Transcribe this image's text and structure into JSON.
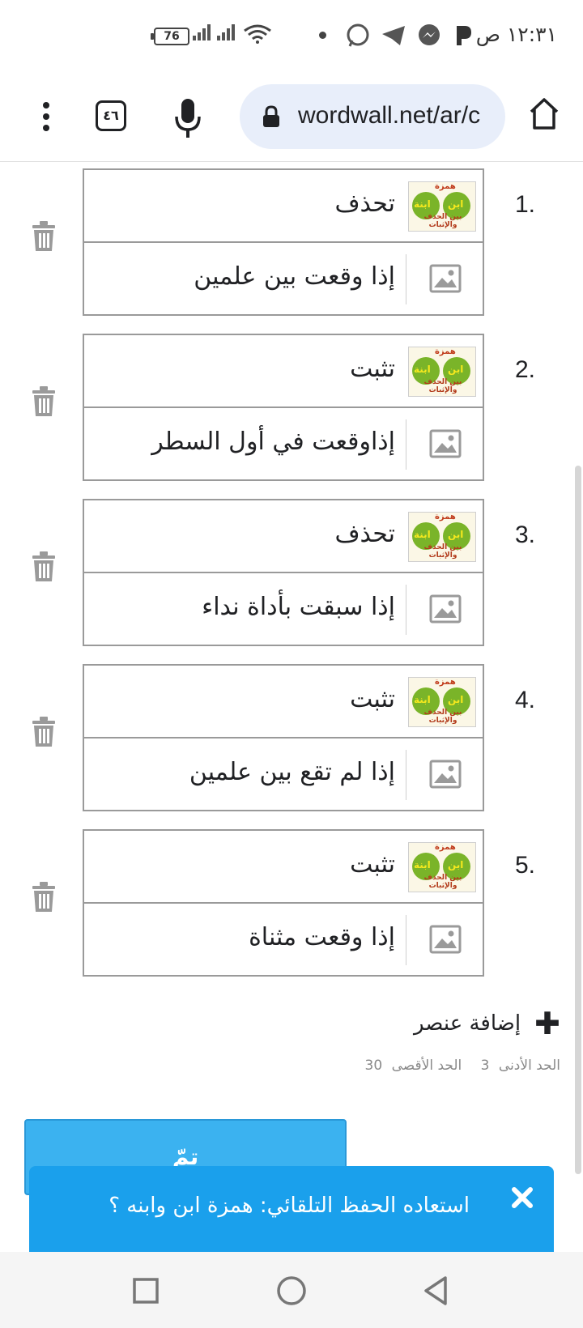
{
  "status_bar": {
    "time": "١٢:٣١ ص",
    "battery": "76",
    "notification_icons": [
      "p-app-icon",
      "messenger-icon",
      "telegram-icon",
      "whatsapp-icon"
    ]
  },
  "browser": {
    "url": "wordwall.net/ar/c",
    "tab_count": "٤٦"
  },
  "items": [
    {
      "number": "1.",
      "top_text": "تحذف",
      "bottom_text": "إذا وقعت بين علمين"
    },
    {
      "number": "2.",
      "top_text": "تثبت",
      "bottom_text": "إذاوقعت في أول السطر"
    },
    {
      "number": "3.",
      "top_text": "تحذف",
      "bottom_text": "إذا سبقت بأداة نداء"
    },
    {
      "number": "4.",
      "top_text": "تثبت",
      "bottom_text": "إذا لم تقع بين علمين"
    },
    {
      "number": "5.",
      "top_text": "تثبت",
      "bottom_text": "إذا وقعت مثناة"
    }
  ],
  "thumbnail": {
    "word_left": "ابنة",
    "word_right": "ابن",
    "top_word": "همزة",
    "footer": "بين الحذف والإثبات"
  },
  "add_item_label": "إضافة عنصر",
  "limits": {
    "min_label": "الحد الأدنى",
    "min_value": "3",
    "max_label": "الحد الأقصى",
    "max_value": "30"
  },
  "done_label": "تمّ",
  "toast": {
    "message": "استعاده الحفظ التلقائي: همزة ابن وابنه ؟"
  },
  "colors": {
    "done_button": "#3bb2f0",
    "toast": "#1aa0ec",
    "url_box": "#e8eefa"
  }
}
